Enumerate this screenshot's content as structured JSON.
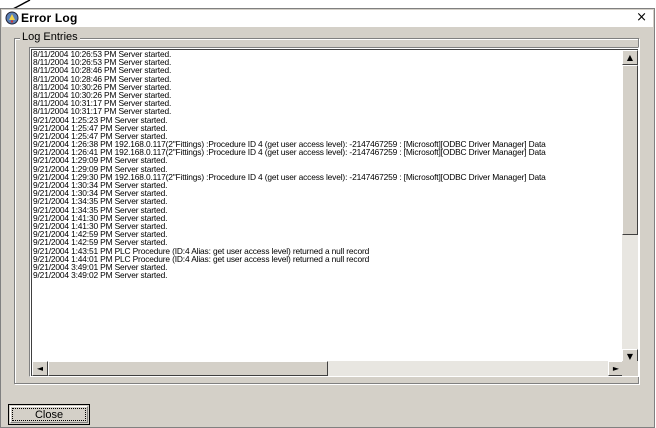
{
  "window": {
    "title": "Error Log",
    "close_glyph": "×",
    "icon": "app-icon"
  },
  "group": {
    "label": "Log Entries"
  },
  "log": {
    "entries": [
      "8/11/2004 10:26:53 PM  Server started.",
      "8/11/2004 10:26:53 PM  Server started.",
      "8/11/2004 10:28:46 PM  Server started.",
      "8/11/2004 10:28:46 PM  Server started.",
      "8/11/2004 10:30:26 PM  Server started.",
      "8/11/2004 10:30:26 PM  Server started.",
      "8/11/2004 10:31:17 PM  Server started.",
      "8/11/2004 10:31:17 PM  Server started.",
      "9/21/2004 1:25:23 PM  Server started.",
      "9/21/2004 1:25:47 PM  Server started.",
      "9/21/2004 1:25:47 PM  Server started.",
      "9/21/2004 1:26:38 PM 192.168.0.117(2\"Fittings) :Procedure ID 4 (get user access level): -2147467259 : [Microsoft][ODBC Driver Manager] Data",
      "9/21/2004 1:26:41 PM 192.168.0.117(2\"Fittings) :Procedure ID 4 (get user access level): -2147467259 : [Microsoft][ODBC Driver Manager] Data",
      "9/21/2004 1:29:09 PM  Server started.",
      "9/21/2004 1:29:09 PM  Server started.",
      "9/21/2004 1:29:30 PM 192.168.0.117(2\"Fittings) :Procedure ID 4 (get user access level): -2147467259 : [Microsoft][ODBC Driver Manager] Data",
      "9/21/2004 1:30:34 PM  Server started.",
      "9/21/2004 1:30:34 PM  Server started.",
      "9/21/2004 1:34:35 PM  Server started.",
      "9/21/2004 1:34:35 PM  Server started.",
      "9/21/2004 1:41:30 PM  Server started.",
      "9/21/2004 1:41:30 PM  Server started.",
      "9/21/2004 1:42:59 PM  Server started.",
      "9/21/2004 1:42:59 PM  Server started.",
      "9/21/2004 1:43:51 PM PLC Procedure (ID:4 Alias: get user access level) returned a null record",
      "9/21/2004 1:44:01 PM PLC Procedure (ID:4 Alias: get user access level) returned a null record",
      "9/21/2004 3:49:01 PM  Server started.",
      "9/21/2004 3:49:02 PM  Server started."
    ]
  },
  "scroll": {
    "up": "▲",
    "down": "▼",
    "left": "◄",
    "right": "►"
  },
  "buttons": {
    "close_label": "Close"
  }
}
